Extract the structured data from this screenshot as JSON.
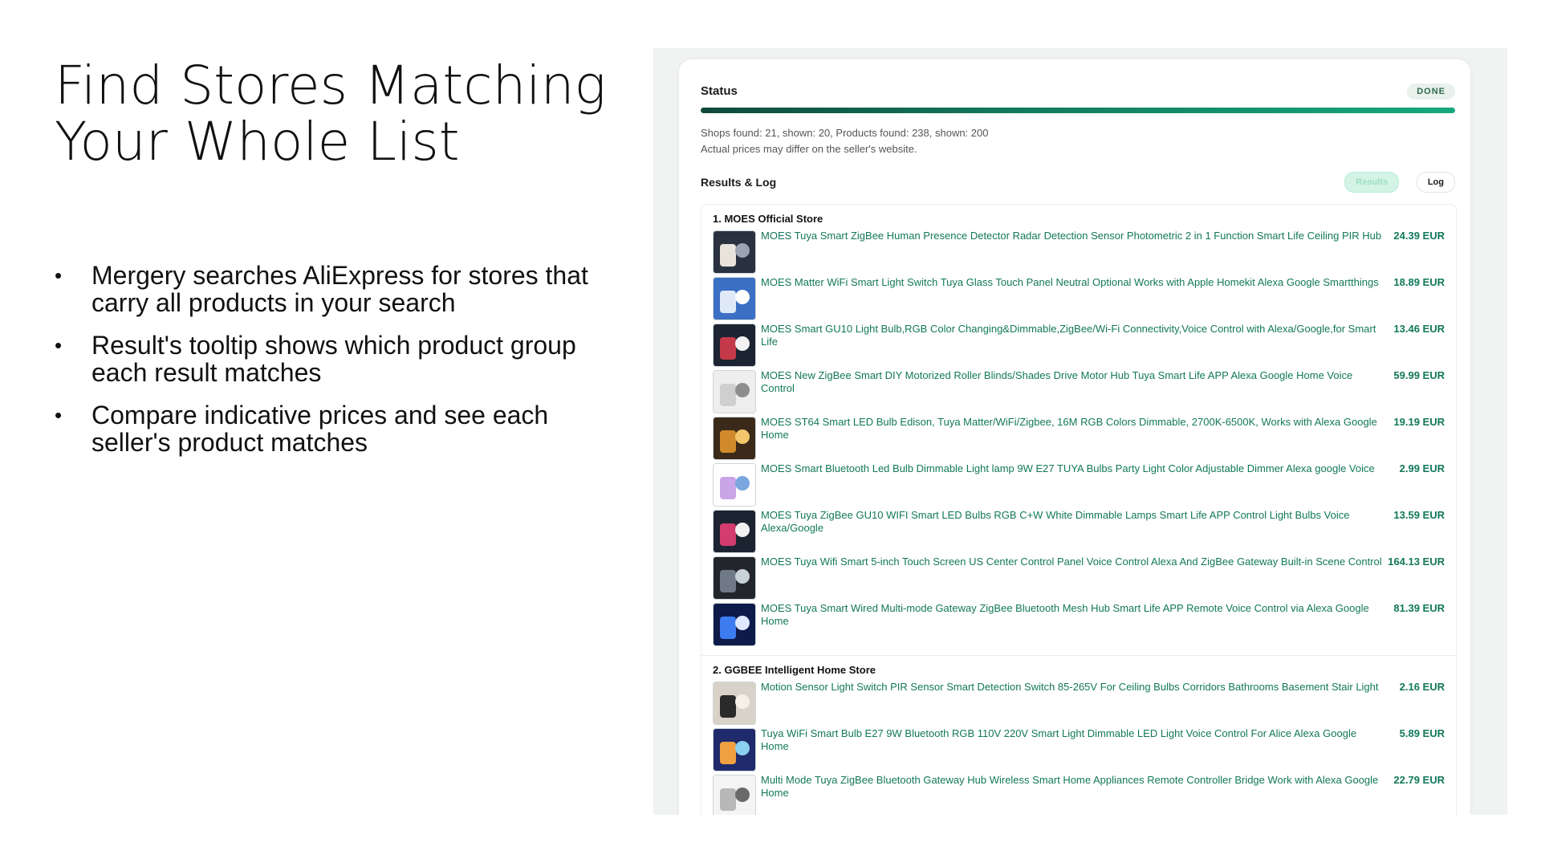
{
  "slide": {
    "title": "Find Stores Matching Your Whole List",
    "bullets": [
      "Mergery searches AliExpress for stores that carry all products in your search",
      "Result's tooltip shows which product group each result matches",
      "Compare indicative prices and see each seller's product matches"
    ],
    "bullet_symbol": "•"
  },
  "status": {
    "label": "Status",
    "badge": "DONE",
    "progress": 1.0,
    "summary": "Shops found: 21, shown: 20, Products found: 238, shown: 200",
    "note": "Actual prices may differ on the seller's website."
  },
  "results": {
    "label": "Results & Log",
    "tabs": [
      "Results",
      "Log"
    ],
    "stores": [
      {
        "name": "1. MOES Official Store",
        "products": [
          {
            "title": "MOES Tuya Smart ZigBee Human Presence Detector Radar Detection Sensor Photometric 2 in 1 Function Smart Life Ceiling PIR Hub",
            "price": "24.39 EUR"
          },
          {
            "title": "MOES Matter WiFi Smart Light Switch Tuya Glass Touch Panel Neutral Optional Works with Apple Homekit Alexa Google Smartthings",
            "price": "18.89 EUR"
          },
          {
            "title": "MOES Smart GU10 Light Bulb,RGB Color Changing&Dimmable,ZigBee/Wi-Fi Connectivity,Voice Control with Alexa/Google,for Smart Life",
            "price": "13.46 EUR"
          },
          {
            "title": "MOES New ZigBee Smart DIY Motorized Roller Blinds/Shades Drive Motor Hub Tuya Smart Life APP Alexa Google Home Voice Control",
            "price": "59.99 EUR"
          },
          {
            "title": "MOES ST64 Smart LED Bulb Edison, Tuya Matter/WiFi/Zigbee, 16M RGB Colors Dimmable, 2700K-6500K, Works with Alexa Google Home",
            "price": "19.19 EUR"
          },
          {
            "title": "MOES Smart Bluetooth Led Bulb Dimmable Light lamp 9W E27 TUYA Bulbs Party Light Color Adjustable Dimmer Alexa google Voice",
            "price": "2.99 EUR"
          },
          {
            "title": "MOES Tuya ZigBee GU10 WIFI Smart LED Bulbs RGB C+W White Dimmable Lamps Smart Life APP Control Light Bulbs Voice Alexa/Google",
            "price": "13.59 EUR"
          },
          {
            "title": "MOES Tuya Wifi Smart 5-inch Touch Screen US Center Control Panel Voice Control Alexa And ZigBee Gateway Built-in Scene Control",
            "price": "164.13 EUR"
          },
          {
            "title": "MOES Tuya Smart Wired Multi-mode Gateway ZigBee Bluetooth Mesh Hub Smart Life APP Remote Voice Control via Alexa Google Home",
            "price": "81.39 EUR"
          }
        ]
      },
      {
        "name": "2. GGBEE Intelligent Home Store",
        "products": [
          {
            "title": "Motion Sensor Light Switch PIR Sensor Smart Detection Switch 85-265V For Ceiling Bulbs Corridors Bathrooms Basement Stair Light",
            "price": "2.16 EUR"
          },
          {
            "title": "Tuya WiFi Smart Bulb E27 9W Bluetooth RGB 110V 220V Smart Light Dimmable LED Light Voice Control For Alice Alexa Google Home",
            "price": "5.89 EUR"
          },
          {
            "title": "Multi Mode Tuya ZigBee Bluetooth Gateway Hub Wireless Smart Home Appliances Remote Controller Bridge Work with Alexa Google Home",
            "price": "22.79 EUR"
          }
        ]
      }
    ]
  },
  "colors": {
    "accent": "#12785a",
    "badge_bg": "#e8f1ec",
    "frame_bg": "#f1f2f2"
  }
}
